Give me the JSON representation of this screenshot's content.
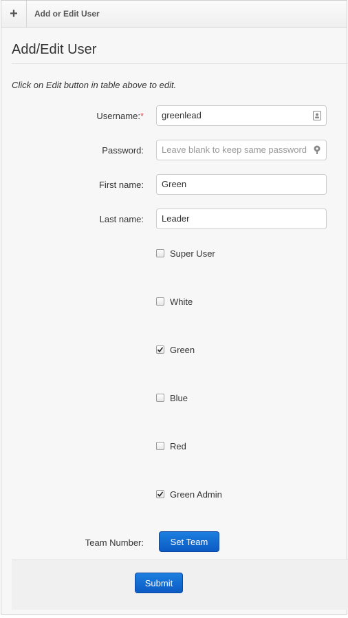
{
  "header": {
    "add_icon": "plus-icon",
    "title": "Add or Edit User"
  },
  "form": {
    "heading": "Add/Edit User",
    "hint": "Click on Edit button in table above to edit.",
    "username": {
      "label": "Username:",
      "required_mark": "*",
      "value": "greenlead",
      "icon": "contact-card-icon"
    },
    "password": {
      "label": "Password:",
      "placeholder": "Leave blank to keep same password",
      "icon": "key-icon"
    },
    "first_name": {
      "label": "First name:",
      "value": "Green"
    },
    "last_name": {
      "label": "Last name:",
      "value": "Leader"
    },
    "roles": [
      {
        "label": "Super User",
        "checked": false
      },
      {
        "label": "White",
        "checked": false
      },
      {
        "label": "Green",
        "checked": true
      },
      {
        "label": "Blue",
        "checked": false
      },
      {
        "label": "Red",
        "checked": false
      },
      {
        "label": "Green Admin",
        "checked": true
      }
    ],
    "team_number": {
      "label": "Team Number:",
      "button": "Set Team"
    },
    "submit": "Submit"
  },
  "colors": {
    "primary_button": "#1565c0",
    "required": "#d9534f"
  }
}
